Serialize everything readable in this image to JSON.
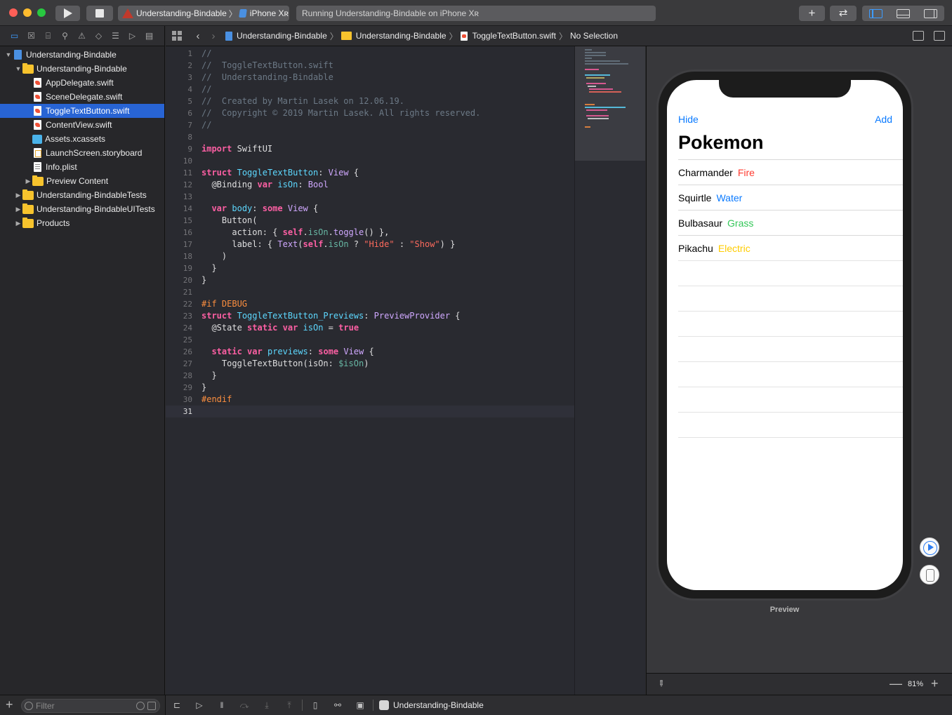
{
  "toolbar": {
    "scheme_name": "Understanding-Bindable",
    "device_name": "iPhone Xʀ",
    "status_text": "Running Understanding-Bindable on iPhone Xʀ",
    "add_label": "+",
    "swap_label": "⇄"
  },
  "navigator": {
    "tabs": [
      "folder-icon",
      "x-square-icon",
      "hierarchy-icon",
      "search-icon",
      "warning-icon",
      "test-diamond-icon",
      "debug-icon",
      "breakpoint-icon",
      "report-icon"
    ],
    "items": [
      {
        "label": "Understanding-Bindable",
        "kind": "project",
        "depth": 0,
        "disclosure": "▼"
      },
      {
        "label": "Understanding-Bindable",
        "kind": "folder",
        "depth": 1,
        "disclosure": "▼"
      },
      {
        "label": "AppDelegate.swift",
        "kind": "swift",
        "depth": 2
      },
      {
        "label": "SceneDelegate.swift",
        "kind": "swift",
        "depth": 2
      },
      {
        "label": "ToggleTextButton.swift",
        "kind": "swift",
        "depth": 2,
        "selected": true
      },
      {
        "label": "ContentView.swift",
        "kind": "swift",
        "depth": 2
      },
      {
        "label": "Assets.xcassets",
        "kind": "assets",
        "depth": 2
      },
      {
        "label": "LaunchScreen.storyboard",
        "kind": "storyboard",
        "depth": 2
      },
      {
        "label": "Info.plist",
        "kind": "plist",
        "depth": 2
      },
      {
        "label": "Preview Content",
        "kind": "folder",
        "depth": 2,
        "disclosure": "▶"
      },
      {
        "label": "Understanding-BindableTests",
        "kind": "folder",
        "depth": 1,
        "disclosure": "▶"
      },
      {
        "label": "Understanding-BindableUITests",
        "kind": "folder",
        "depth": 1,
        "disclosure": "▶"
      },
      {
        "label": "Products",
        "kind": "folder",
        "depth": 1,
        "disclosure": "▶"
      }
    ],
    "filter_placeholder": "Filter",
    "add_label": "+"
  },
  "jumpbar": {
    "crumbs": [
      "Understanding-Bindable",
      "Understanding-Bindable",
      "ToggleTextButton.swift",
      "No Selection"
    ]
  },
  "editor": {
    "current_line": 31,
    "lines": [
      [
        [
          "cm",
          "//"
        ]
      ],
      [
        [
          "cm",
          "//  ToggleTextButton.swift"
        ]
      ],
      [
        [
          "cm",
          "//  Understanding-Bindable"
        ]
      ],
      [
        [
          "cm",
          "//"
        ]
      ],
      [
        [
          "cm",
          "//  Created by Martin Lasek on 12.06.19."
        ]
      ],
      [
        [
          "cm",
          "//  Copyright © 2019 Martin Lasek. All rights reserved."
        ]
      ],
      [
        [
          "cm",
          "//"
        ]
      ],
      [],
      [
        [
          "kw",
          "import"
        ],
        [
          "",
          " SwiftUI"
        ]
      ],
      [],
      [
        [
          "kw",
          "struct"
        ],
        [
          "",
          " "
        ],
        [
          "ty",
          "ToggleTextButton"
        ],
        [
          "",
          ": "
        ],
        [
          "tyo",
          "View"
        ],
        [
          "",
          " {"
        ]
      ],
      [
        [
          "",
          "  @Binding "
        ],
        [
          "kw",
          "var"
        ],
        [
          "",
          " "
        ],
        [
          "ty",
          "isOn"
        ],
        [
          "",
          ": "
        ],
        [
          "tyo",
          "Bool"
        ]
      ],
      [],
      [
        [
          "",
          "  "
        ],
        [
          "kw",
          "var"
        ],
        [
          "",
          " "
        ],
        [
          "ty",
          "body"
        ],
        [
          "",
          ": "
        ],
        [
          "kw",
          "some"
        ],
        [
          "",
          " "
        ],
        [
          "tyo",
          "View"
        ],
        [
          "",
          " {"
        ]
      ],
      [
        [
          "",
          "    Button("
        ]
      ],
      [
        [
          "",
          "      action: { "
        ],
        [
          "kw",
          "self"
        ],
        [
          "",
          "."
        ],
        [
          "fn",
          "isOn"
        ],
        [
          "",
          "."
        ],
        [
          "tyo",
          "toggle"
        ],
        [
          "",
          "() },"
        ]
      ],
      [
        [
          "",
          "      label: { "
        ],
        [
          "tyo",
          "Text"
        ],
        [
          "",
          "("
        ],
        [
          "kw",
          "self"
        ],
        [
          "",
          "."
        ],
        [
          "fn",
          "isOn"
        ],
        [
          "",
          " ? "
        ],
        [
          "st",
          "\"Hide\""
        ],
        [
          "",
          " : "
        ],
        [
          "st",
          "\"Show\""
        ],
        [
          "",
          ") }"
        ]
      ],
      [
        [
          "",
          "    )"
        ]
      ],
      [
        [
          "",
          "  }"
        ]
      ],
      [
        [
          "",
          "}"
        ]
      ],
      [],
      [
        [
          "pp",
          "#if DEBUG"
        ]
      ],
      [
        [
          "kw",
          "struct"
        ],
        [
          "",
          " "
        ],
        [
          "ty",
          "ToggleTextButton_Previews"
        ],
        [
          "",
          ": "
        ],
        [
          "tyo",
          "PreviewProvider"
        ],
        [
          "",
          " {"
        ]
      ],
      [
        [
          "",
          "  @State "
        ],
        [
          "kw",
          "static"
        ],
        [
          "",
          " "
        ],
        [
          "kw",
          "var"
        ],
        [
          "",
          " "
        ],
        [
          "ty",
          "isOn"
        ],
        [
          "",
          " = "
        ],
        [
          "kw",
          "true"
        ]
      ],
      [],
      [
        [
          "",
          "  "
        ],
        [
          "kw",
          "static"
        ],
        [
          "",
          " "
        ],
        [
          "kw",
          "var"
        ],
        [
          "",
          " "
        ],
        [
          "ty",
          "previews"
        ],
        [
          "",
          ": "
        ],
        [
          "kw",
          "some"
        ],
        [
          "",
          " "
        ],
        [
          "tyo",
          "View"
        ],
        [
          "",
          " {"
        ]
      ],
      [
        [
          "",
          "    ToggleTextButton(isOn: "
        ],
        [
          "fn",
          "$isOn"
        ],
        [
          "",
          ")"
        ]
      ],
      [
        [
          "",
          "  }"
        ]
      ],
      [
        [
          "",
          "}"
        ]
      ],
      [
        [
          "pp",
          "#endif"
        ]
      ],
      []
    ]
  },
  "preview": {
    "nav_left": "Hide",
    "nav_right": "Add",
    "title": "Pokemon",
    "rows": [
      {
        "name": "Charmander",
        "type": "Fire",
        "color": "#ff3b30"
      },
      {
        "name": "Squirtle",
        "type": "Water",
        "color": "#0a7aff"
      },
      {
        "name": "Bulbasaur",
        "type": "Grass",
        "color": "#34c759"
      },
      {
        "name": "Pikachu",
        "type": "Electric",
        "color": "#ffcc00"
      }
    ],
    "empty_rows": 7,
    "label": "Preview",
    "zoom": "81%",
    "zoom_minus": "—",
    "zoom_plus": "+"
  },
  "debugbar": {
    "icons": [
      "hide-console-icon",
      "breakpoints-toggle-icon",
      "pause-icon",
      "step-over-icon",
      "step-in-icon",
      "step-out-icon",
      "view-debugger-icon",
      "memory-graph-icon",
      "environment-icon"
    ],
    "target": "Understanding-Bindable"
  }
}
